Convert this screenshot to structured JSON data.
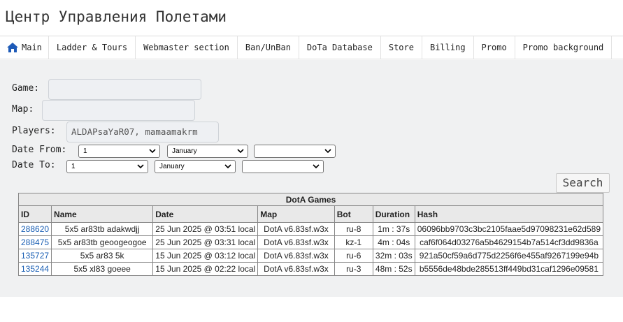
{
  "site": {
    "title": "Центр Управления Полетами"
  },
  "nav": {
    "items": [
      {
        "label": "Main",
        "icon": "home-icon"
      },
      {
        "label": "Ladder & Tours"
      },
      {
        "label": "Webmaster section"
      },
      {
        "label": "Ban/UnBan"
      },
      {
        "label": "DoTa Database"
      },
      {
        "label": "Store"
      },
      {
        "label": "Billing"
      },
      {
        "label": "Promo"
      },
      {
        "label": "Promo background"
      }
    ]
  },
  "form": {
    "game_label": "Game:",
    "game_value": "",
    "map_label": "Map:",
    "map_value": "",
    "players_label": "Players:",
    "players_value": "ALDAPsaYaR07, mamaamakrm",
    "date_from_label": "Date From:",
    "date_to_label": "Date To:",
    "date_from": {
      "day": "1",
      "month": "January",
      "year": ""
    },
    "date_to": {
      "day": "1",
      "month": "January",
      "year": ""
    },
    "search_label": "Search"
  },
  "table": {
    "caption": "DotA Games",
    "columns": [
      "ID",
      "Name",
      "Date",
      "Map",
      "Bot",
      "Duration",
      "Hash"
    ],
    "rows": [
      {
        "id": "288620",
        "name": "5x5 ar83tb adakwdjj",
        "date": "25 Jun 2025 @ 03:51 local",
        "map": "DotA v6.83sf.w3x",
        "bot": "ru-8",
        "duration": "1m : 37s",
        "hash": "06096bb9703c3bc2105faae5d97098231e62d589"
      },
      {
        "id": "288475",
        "name": "5x5 ar83tb geoogeogoe",
        "date": "25 Jun 2025 @ 03:31 local",
        "map": "DotA v6.83sf.w3x",
        "bot": "kz-1",
        "duration": "4m : 04s",
        "hash": "caf6f064d03276a5b4629154b7a514cf3dd9836a"
      },
      {
        "id": "135727",
        "name": "5x5 ar83 5k",
        "date": "15 Jun 2025 @ 03:12 local",
        "map": "DotA v6.83sf.w3x",
        "bot": "ru-6",
        "duration": "32m : 03s",
        "hash": "921a50cf59a6d775d2256f6e455af9267199e94b"
      },
      {
        "id": "135244",
        "name": "5x5 xl83 goeee",
        "date": "15 Jun 2025 @ 02:22 local",
        "map": "DotA v6.83sf.w3x",
        "bot": "ru-3",
        "duration": "48m : 52s",
        "hash": "b5556de48bde285513ff449bd31caf1296e09581"
      }
    ]
  },
  "colors": {
    "link": "#1a5fb4",
    "home_icon": "#1e5bb8",
    "panel_bg": "#f0f1f2"
  }
}
